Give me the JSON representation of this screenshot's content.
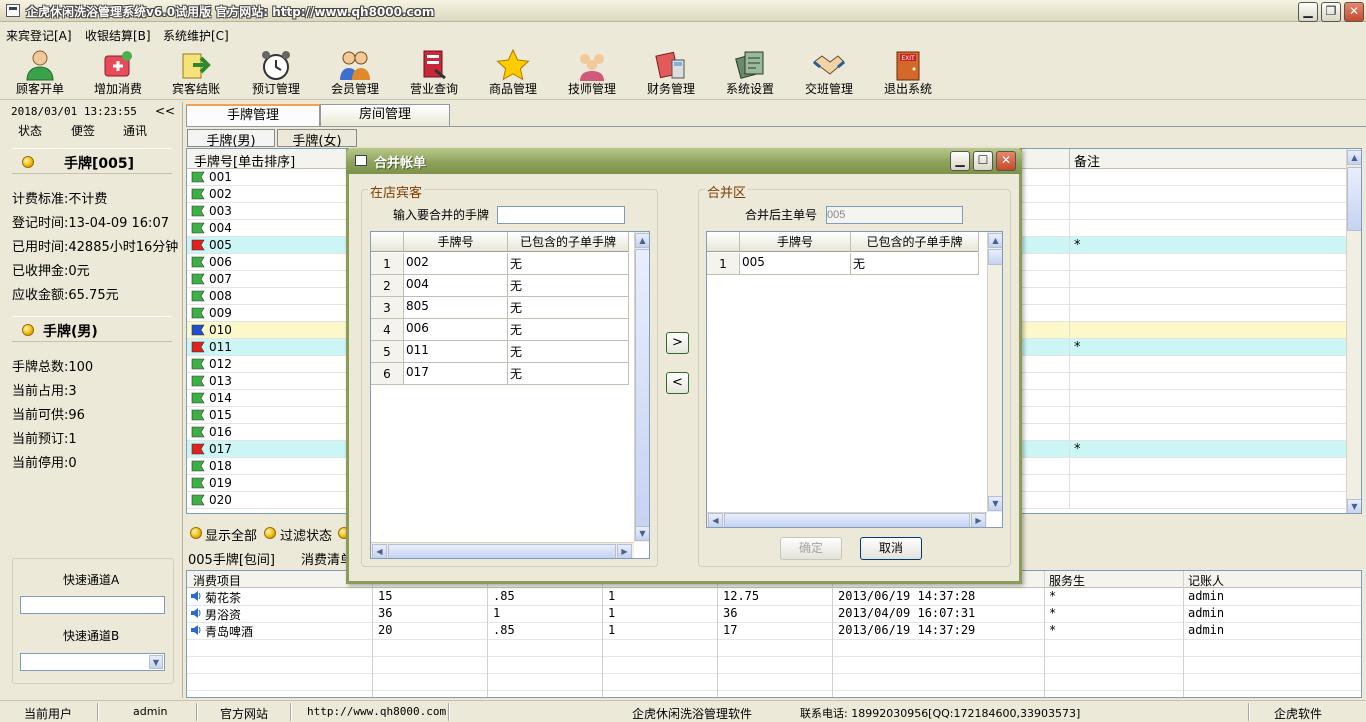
{
  "window": {
    "title": "企虎休闲洗浴管理系统v6.0试用版   官方网站: http://www.qh8000.com"
  },
  "menu": [
    "来宾登记[A]",
    "收银结算[B]",
    "系统维护[C]"
  ],
  "toolbar": [
    {
      "label": "顾客开单",
      "icon": "person-add-icon"
    },
    {
      "label": "增加消费",
      "icon": "add-consumption-icon"
    },
    {
      "label": "宾客结账",
      "icon": "checkout-arrow-icon"
    },
    {
      "label": "预订管理",
      "icon": "alarm-clock-icon"
    },
    {
      "label": "会员管理",
      "icon": "members-icon"
    },
    {
      "label": "营业查询",
      "icon": "business-query-icon"
    },
    {
      "label": "商品管理",
      "icon": "star-icon"
    },
    {
      "label": "技师管理",
      "icon": "technician-icon"
    },
    {
      "label": "财务管理",
      "icon": "finance-icon"
    },
    {
      "label": "系统设置",
      "icon": "settings-icon"
    },
    {
      "label": "交班管理",
      "icon": "handshake-icon"
    },
    {
      "label": "退出系统",
      "icon": "exit-icon"
    }
  ],
  "left": {
    "datetime": "2018/03/01 13:23:55",
    "collapse": "<<",
    "tabs": [
      "状态",
      "便签",
      "通讯"
    ],
    "card_title": "手牌[005]",
    "card_lines": [
      "计费标准:不计费",
      "登记时间:13-04-09 16:07",
      "已用时间:42885小时16分钟",
      "已收押金:0元",
      "应收金额:65.75元"
    ],
    "group_title": "手牌(男)",
    "group_lines": [
      "手牌总数:100",
      "当前占用:3",
      "当前可供:96",
      "当前预订:1",
      "当前停用:0"
    ],
    "quick_a": "快速通道A",
    "quick_b": "快速通道B"
  },
  "main": {
    "tabs": [
      "手牌管理",
      "房间管理"
    ],
    "subtabs": [
      "手牌(男)",
      "手牌(女)"
    ],
    "col_handcard": "手牌号[单击排序]",
    "col_remark": "备注",
    "rows": [
      {
        "no": "001",
        "flag": "green",
        "mark": ""
      },
      {
        "no": "002",
        "flag": "green",
        "mark": ""
      },
      {
        "no": "003",
        "flag": "green",
        "mark": ""
      },
      {
        "no": "004",
        "flag": "green",
        "mark": ""
      },
      {
        "no": "005",
        "flag": "red",
        "mark": "*",
        "hl": "cyan"
      },
      {
        "no": "006",
        "flag": "green",
        "mark": ""
      },
      {
        "no": "007",
        "flag": "green",
        "mark": ""
      },
      {
        "no": "008",
        "flag": "green",
        "mark": ""
      },
      {
        "no": "009",
        "flag": "green",
        "mark": ""
      },
      {
        "no": "010",
        "flag": "blue",
        "mark": "",
        "hl": "yellow"
      },
      {
        "no": "011",
        "flag": "red",
        "mark": "*",
        "hl": "cyan"
      },
      {
        "no": "012",
        "flag": "green",
        "mark": ""
      },
      {
        "no": "013",
        "flag": "green",
        "mark": ""
      },
      {
        "no": "014",
        "flag": "green",
        "mark": ""
      },
      {
        "no": "015",
        "flag": "green",
        "mark": ""
      },
      {
        "no": "016",
        "flag": "green",
        "mark": ""
      },
      {
        "no": "017",
        "flag": "red",
        "mark": "*",
        "hl": "cyan"
      },
      {
        "no": "018",
        "flag": "green",
        "mark": ""
      },
      {
        "no": "019",
        "flag": "green",
        "mark": ""
      },
      {
        "no": "020",
        "flag": "green",
        "mark": ""
      }
    ],
    "show_all": "显示全部",
    "filter": "过滤状态",
    "current_card": "005手牌[包间]",
    "consume_label": "消费清单"
  },
  "consumption": {
    "headers": [
      "消费项目",
      "",
      "",
      "",
      "",
      "",
      "服务生",
      "记账人"
    ],
    "rows": [
      [
        "菊花茶",
        "15",
        ".85",
        "1",
        "12.75",
        "2013/06/19 14:37:28",
        "*",
        "admin"
      ],
      [
        "男浴资",
        "36",
        "1",
        "1",
        "36",
        "2013/04/09 16:07:31",
        "*",
        "admin"
      ],
      [
        "青岛啤酒",
        "20",
        ".85",
        "1",
        "17",
        "2013/06/19 14:37:29",
        "*",
        "admin"
      ]
    ]
  },
  "status": {
    "user_label": "当前用户",
    "user": "admin",
    "site_label": "官方网站",
    "site": "http://www.qh8000.com",
    "product": "企虎休闲洗浴管理软件",
    "contact": "联系电话: 18992030956[QQ:172184600,33903573]",
    "brand": "企虎软件"
  },
  "dialog": {
    "title": "合并帐单",
    "left_group": "在店宾客",
    "input_label": "输入要合并的手牌",
    "input_value": "",
    "right_group": "合并区",
    "main_label": "合并后主单号",
    "main_value": "005",
    "col1": "手牌号",
    "col2": "已包含的子单手牌",
    "left_rows": [
      {
        "n": "1",
        "card": "002",
        "sub": "无"
      },
      {
        "n": "2",
        "card": "004",
        "sub": "无"
      },
      {
        "n": "3",
        "card": "805",
        "sub": "无"
      },
      {
        "n": "4",
        "card": "006",
        "sub": "无"
      },
      {
        "n": "5",
        "card": "011",
        "sub": "无"
      },
      {
        "n": "6",
        "card": "017",
        "sub": "无"
      }
    ],
    "right_rows": [
      {
        "n": "1",
        "card": "005",
        "sub": "无"
      }
    ],
    "move_right": ">",
    "move_left": "<",
    "ok": "确定",
    "cancel": "取消"
  }
}
